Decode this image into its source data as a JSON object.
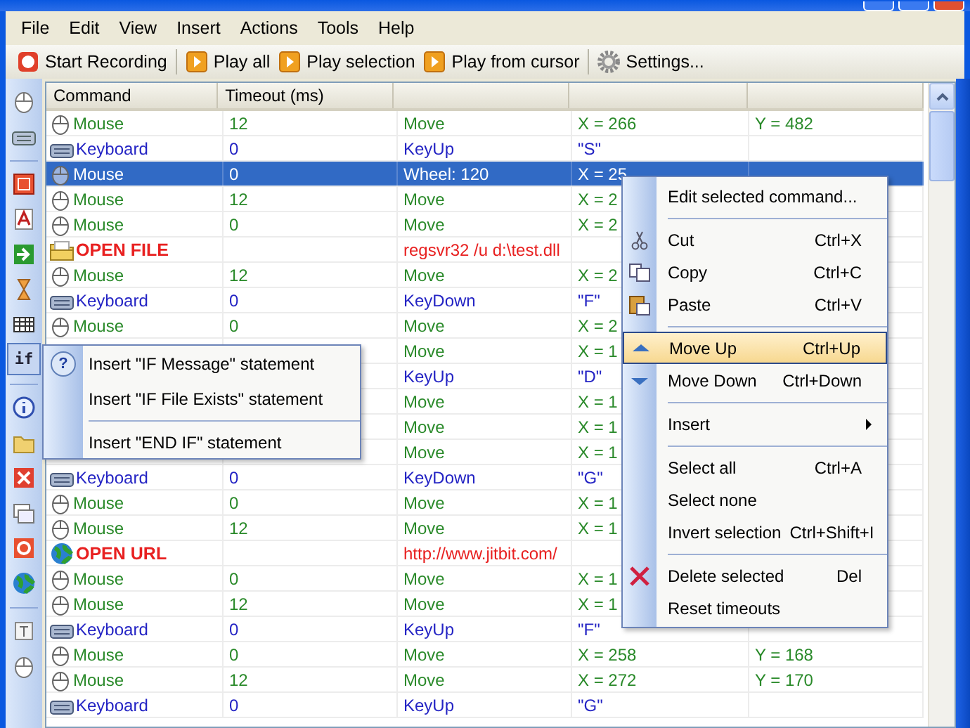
{
  "menu_bar": [
    "File",
    "Edit",
    "View",
    "Insert",
    "Actions",
    "Tools",
    "Help"
  ],
  "toolbar": [
    {
      "kind": "record",
      "label": "Start Recording"
    },
    {
      "kind": "separator"
    },
    {
      "kind": "play",
      "label": "Play all"
    },
    {
      "kind": "play",
      "label": "Play selection"
    },
    {
      "kind": "play",
      "label": "Play from cursor"
    },
    {
      "kind": "separator"
    },
    {
      "kind": "settings",
      "label": "Settings..."
    }
  ],
  "left_toolbar": [
    {
      "kind": "button",
      "selected": false
    },
    {
      "kind": "button",
      "selected": false
    },
    {
      "kind": "separator"
    },
    {
      "kind": "button",
      "selected": false
    },
    {
      "kind": "button",
      "selected": false
    },
    {
      "kind": "button",
      "selected": false
    },
    {
      "kind": "button",
      "selected": false
    },
    {
      "kind": "button",
      "selected": false
    },
    {
      "kind": "button",
      "label": "if",
      "selected": true
    },
    {
      "kind": "separator"
    },
    {
      "kind": "button",
      "selected": false
    },
    {
      "kind": "button",
      "selected": false
    },
    {
      "kind": "button",
      "selected": false
    },
    {
      "kind": "button",
      "selected": false
    },
    {
      "kind": "button",
      "selected": false
    },
    {
      "kind": "button",
      "selected": false
    },
    {
      "kind": "separator"
    },
    {
      "kind": "button",
      "selected": false
    },
    {
      "kind": "button",
      "selected": false
    }
  ],
  "table": {
    "columns": [
      "Command",
      "Timeout (ms)",
      "",
      "",
      ""
    ],
    "rows": [
      {
        "kind": "mouse",
        "command": "Mouse",
        "timeout": "12",
        "action": "Move",
        "column_4": "X = 266",
        "column_5": "Y = 482",
        "selected": false
      },
      {
        "kind": "keyboard",
        "command": "Keyboard",
        "timeout": "0",
        "action": "KeyUp",
        "column_4": "\"S\"",
        "selected": false
      },
      {
        "kind": "mouse",
        "command": "Mouse",
        "timeout": "0",
        "action": "Wheel: 120",
        "column_4": "X = 25",
        "selected": true
      },
      {
        "kind": "mouse",
        "command": "Mouse",
        "timeout": "12",
        "action": "Move",
        "column_4": "X = 2",
        "selected": false
      },
      {
        "kind": "mouse",
        "command": "Mouse",
        "timeout": "0",
        "action": "Move",
        "column_4": "X = 2",
        "selected": false
      },
      {
        "kind": "open",
        "command": "OPEN FILE",
        "action": "regsvr32 /u d:\\test.dll",
        "selected": false
      },
      {
        "kind": "mouse",
        "command": "Mouse",
        "timeout": "12",
        "action": "Move",
        "column_4": "X = 2",
        "selected": false
      },
      {
        "kind": "keyboard",
        "command": "Keyboard",
        "timeout": "0",
        "action": "KeyDown",
        "column_4": "\"F\"",
        "selected": false
      },
      {
        "kind": "mouse",
        "command": "Mouse",
        "timeout": "0",
        "action": "Move",
        "column_4": "X = 2",
        "selected": false
      },
      {
        "kind": "mouse",
        "action": "Move",
        "column_4": "X = 1",
        "selected": false
      },
      {
        "kind": "keyboard",
        "action": "KeyUp",
        "column_4": "\"D\"",
        "selected": false
      },
      {
        "kind": "mouse",
        "action": "Move",
        "column_4": "X = 1",
        "selected": false
      },
      {
        "kind": "mouse",
        "action": "Move",
        "column_4": "X = 1",
        "selected": false
      },
      {
        "kind": "mouse",
        "action": "Move",
        "column_4": "X = 1",
        "selected": false
      },
      {
        "kind": "keyboard",
        "command": "Keyboard",
        "timeout": "0",
        "action": "KeyDown",
        "column_4": "\"G\"",
        "selected": false
      },
      {
        "kind": "mouse",
        "command": "Mouse",
        "timeout": "0",
        "action": "Move",
        "column_4": "X = 1",
        "selected": false
      },
      {
        "kind": "mouse",
        "command": "Mouse",
        "timeout": "12",
        "action": "Move",
        "column_4": "X = 1",
        "selected": false
      },
      {
        "kind": "url",
        "command": "OPEN URL",
        "action": "http://www.jitbit.com/",
        "selected": false
      },
      {
        "kind": "mouse",
        "command": "Mouse",
        "timeout": "0",
        "action": "Move",
        "column_4": "X = 1",
        "selected": false
      },
      {
        "kind": "mouse",
        "command": "Mouse",
        "timeout": "12",
        "action": "Move",
        "column_4": "X = 1",
        "selected": false
      },
      {
        "kind": "keyboard",
        "command": "Keyboard",
        "timeout": "0",
        "action": "KeyUp",
        "column_4": "\"F\"",
        "selected": false
      },
      {
        "kind": "mouse",
        "command": "Mouse",
        "timeout": "0",
        "action": "Move",
        "column_4": "X = 258",
        "column_5": "Y = 168",
        "selected": false
      },
      {
        "kind": "mouse",
        "command": "Mouse",
        "timeout": "12",
        "action": "Move",
        "column_4": "X = 272",
        "column_5": "Y = 170",
        "selected": false
      },
      {
        "kind": "keyboard",
        "command": "Keyboard",
        "timeout": "0",
        "action": "KeyUp",
        "column_4": "\"G\"",
        "selected": false
      }
    ]
  },
  "if_menu": {
    "icon_text": "?",
    "items": [
      {
        "kind": "item",
        "label": "Insert \"IF Message\" statement"
      },
      {
        "kind": "item",
        "label": "Insert \"IF File Exists\" statement"
      },
      {
        "kind": "separator"
      },
      {
        "kind": "item",
        "label": "Insert \"END IF\" statement"
      }
    ]
  },
  "context_menu": [
    {
      "kind": "item",
      "label": "Edit selected command...",
      "selected": false
    },
    {
      "kind": "separator"
    },
    {
      "kind": "item",
      "label": "Cut",
      "shortcut": "Ctrl+X",
      "selected": false
    },
    {
      "kind": "item",
      "label": "Copy",
      "shortcut": "Ctrl+C",
      "selected": false
    },
    {
      "kind": "item",
      "label": "Paste",
      "shortcut": "Ctrl+V",
      "selected": false
    },
    {
      "kind": "separator"
    },
    {
      "kind": "item",
      "label": "Move Up",
      "shortcut": "Ctrl+Up",
      "selected": true
    },
    {
      "kind": "item",
      "label": "Move Down",
      "shortcut": "Ctrl+Down",
      "selected": false
    },
    {
      "kind": "separator"
    },
    {
      "kind": "item",
      "label": "Insert",
      "submenu": true,
      "selected": false
    },
    {
      "kind": "separator"
    },
    {
      "kind": "item",
      "label": "Select all",
      "shortcut": "Ctrl+A",
      "selected": false
    },
    {
      "kind": "item",
      "label": "Select none",
      "selected": false
    },
    {
      "kind": "item",
      "label": "Invert selection",
      "shortcut": "Ctrl+Shift+I",
      "selected": false
    },
    {
      "kind": "separator"
    },
    {
      "kind": "item",
      "label": "Delete selected",
      "shortcut": "Del",
      "selected": false
    },
    {
      "kind": "item",
      "label": "Reset timeouts",
      "selected": false
    }
  ]
}
